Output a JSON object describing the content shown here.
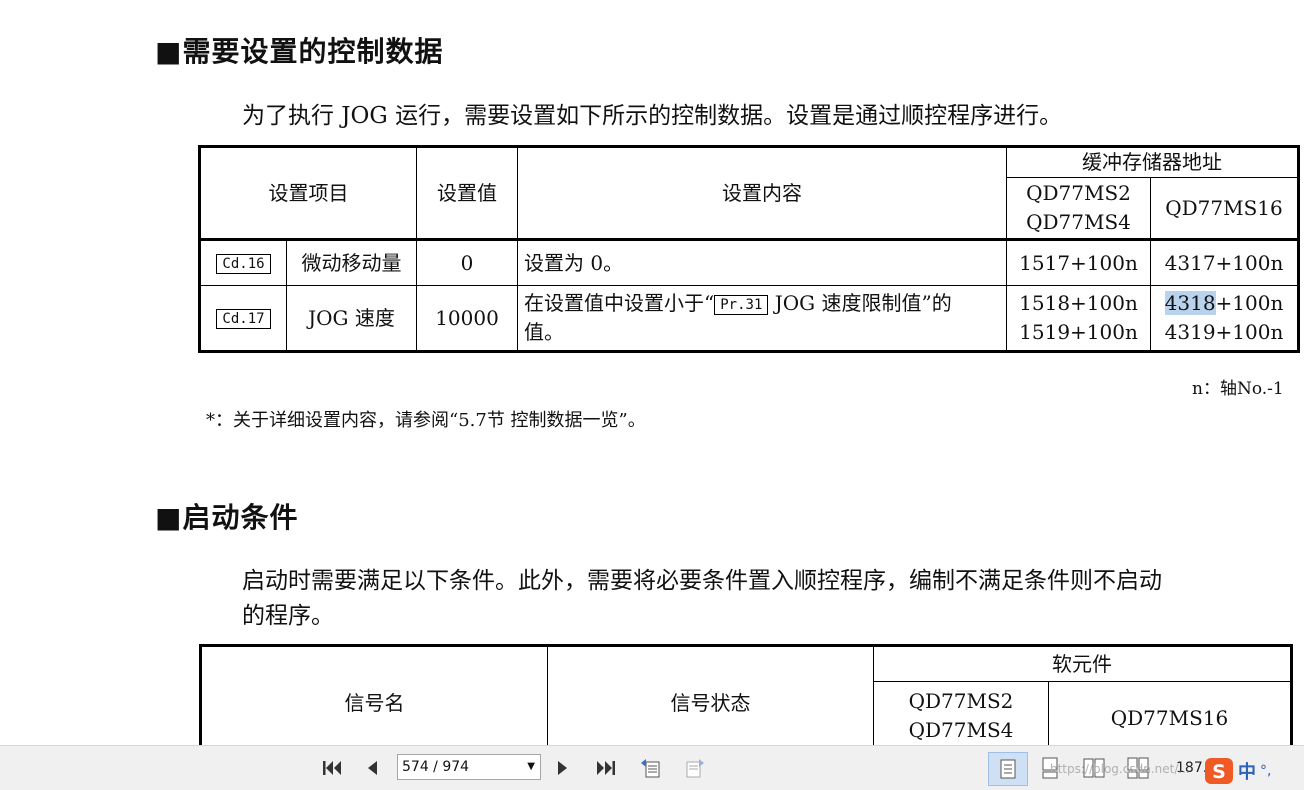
{
  "section1": {
    "heading": "■需要设置的控制数据",
    "intro": "为了执行 JOG 运行，需要设置如下所示的控制数据。设置是通过顺控程序进行。",
    "table": {
      "h_item": "设置项目",
      "h_value": "设置值",
      "h_content": "设置内容",
      "h_buffer": "缓冲存储器地址",
      "h_model_a1": "QD77MS2",
      "h_model_a2": "QD77MS4",
      "h_model_b": "QD77MS16",
      "rows": [
        {
          "code": "Cd.16",
          "name": "微动移动量",
          "value": "0",
          "content": "设置为 0。",
          "addr_a": [
            "1517+100n"
          ],
          "addr_b": [
            "4317+100n"
          ]
        },
        {
          "code": "Cd.17",
          "name": "JOG 速度",
          "value": "10000",
          "content_pre": "在设置值中设置小于“",
          "content_ref": "Pr.31",
          "content_post": " JOG 速度限制值”的",
          "content_line2": "值。",
          "addr_a": [
            "1518+100n",
            "1519+100n"
          ],
          "addr_b_hl": "4318",
          "addr_b_rest": "+100n",
          "addr_b2": "4319+100n"
        }
      ]
    },
    "note_n": "n：轴No.-1",
    "footnote": "*：关于详细设置内容，请参阅“5.7节 控制数据一览”。"
  },
  "section2": {
    "heading": "■启动条件",
    "line1": "启动时需要满足以下条件。此外，需要将必要条件置入顺控程序，编制不满足条件则不启动",
    "line2": "的程序。",
    "table": {
      "h_signal": "信号名",
      "h_state": "信号状态",
      "h_device": "软元件",
      "h_model_a1": "QD77MS2",
      "h_model_a2": "QD77MS4",
      "h_model_b": "QD77MS16"
    }
  },
  "toolbar": {
    "page": "574 / 974",
    "zoom": "187.",
    "icons": [
      "first-page-icon",
      "prev-page-icon",
      "next-page-icon",
      "last-page-icon",
      "prev-view-icon",
      "next-view-icon",
      "single-page-icon",
      "continuous-icon",
      "facing-icon",
      "continuous-facing-icon"
    ]
  },
  "watermark": "https://blog.csdn.net/...",
  "ime": {
    "brand_icon": "sogou-icon",
    "lang": "中",
    "punct": "°,"
  }
}
